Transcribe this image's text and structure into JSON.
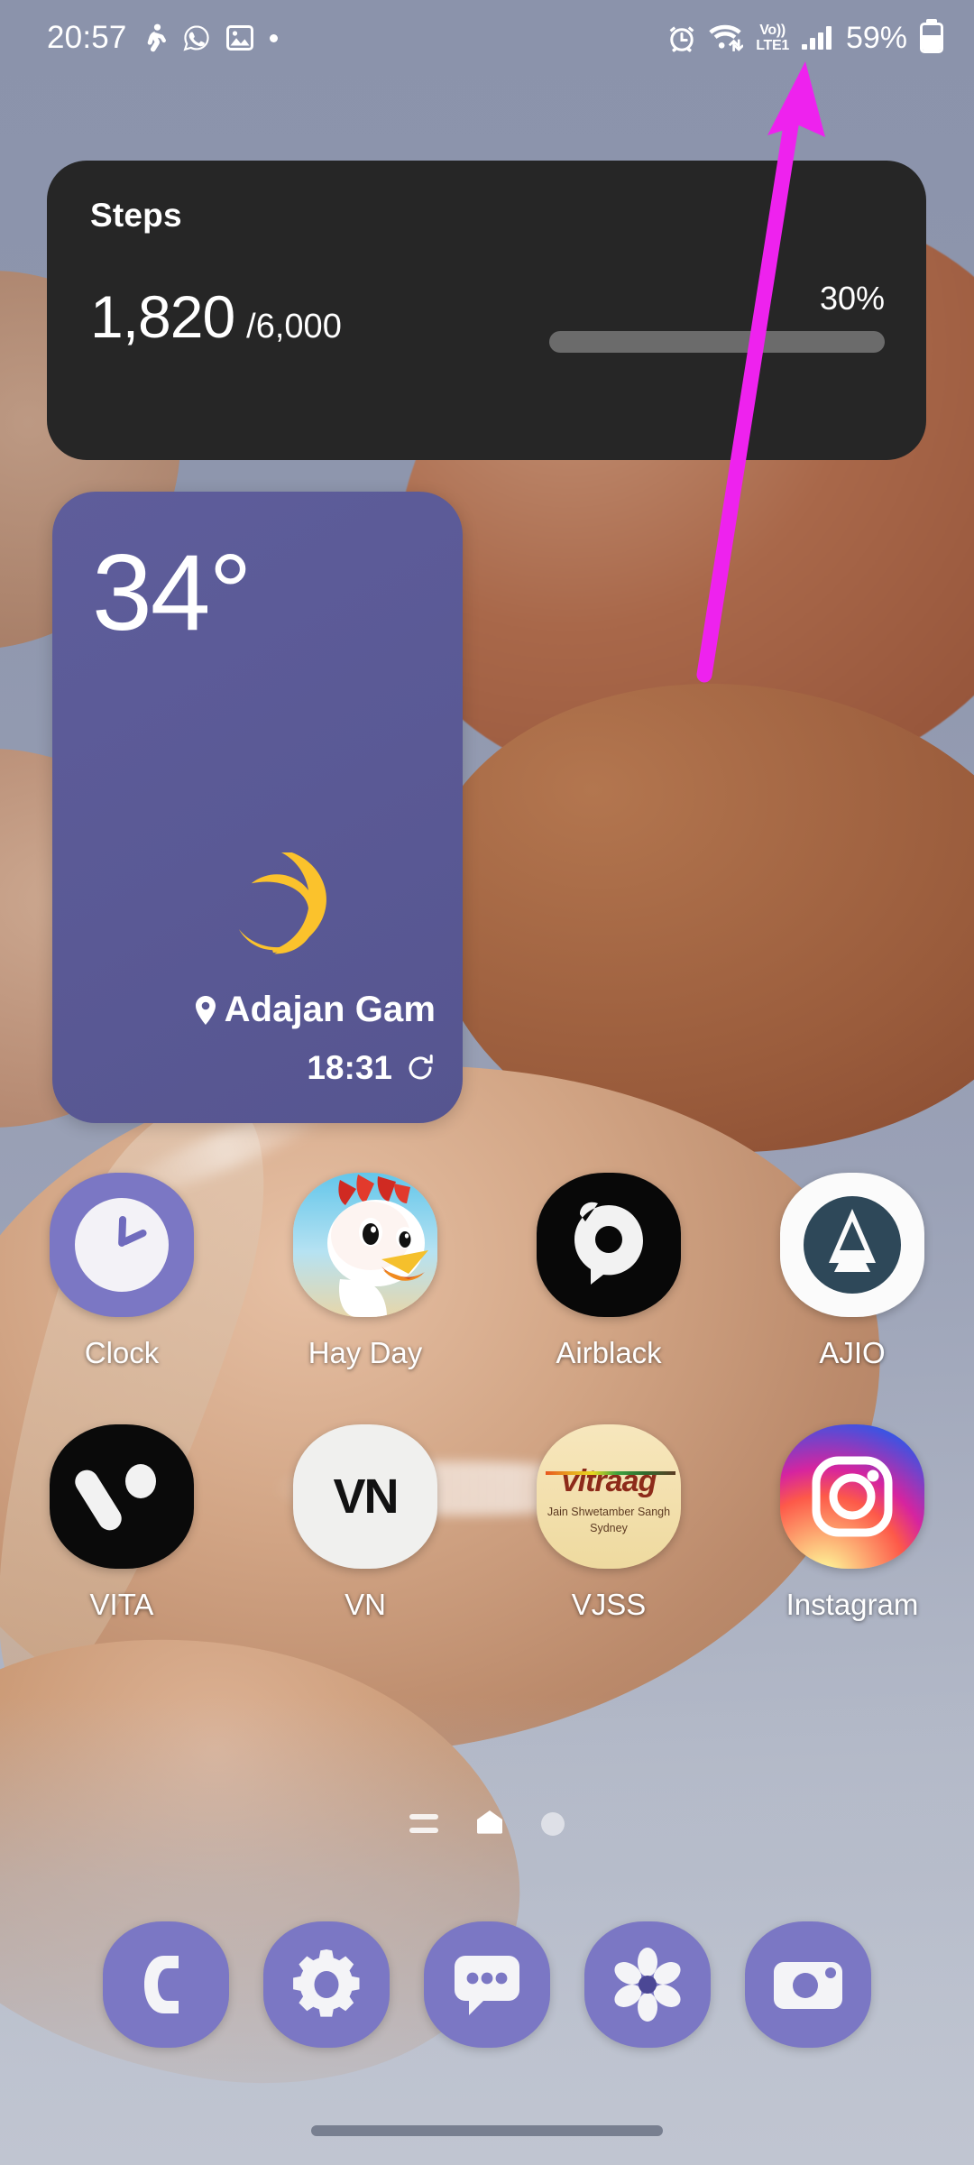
{
  "status_bar": {
    "time": "20:57",
    "left_icons": [
      "running-person-icon",
      "whatsapp-icon",
      "gallery-image-icon",
      "more-notifications-dot"
    ],
    "alarm_icon": "alarm-icon",
    "wifi_icon": "wifi-icon",
    "volte_line1": "Vo))",
    "volte_line2": "LTE1",
    "signal_icon": "signal-bars-icon",
    "battery_percent": "59%",
    "battery_level": 59
  },
  "steps_widget": {
    "title": "Steps",
    "count": "1,820",
    "goal": "/6,000",
    "percent_label": "30%",
    "progress": 30,
    "bar_color": "#26ab5f",
    "track_color": "#6b6b6b",
    "background": "#262626"
  },
  "weather_widget": {
    "temperature": "34°",
    "condition_icon": "crescent-moon-icon",
    "location": "Adajan Gam",
    "location_icon": "location-pin-icon",
    "updated_time": "18:31",
    "refresh_icon": "refresh-icon",
    "background": "#5b5a97"
  },
  "app_grid": {
    "rows": [
      [
        {
          "label": "Clock",
          "icon": "clock-app-icon"
        },
        {
          "label": "Hay Day",
          "icon": "hay-day-app-icon"
        },
        {
          "label": "Airblack",
          "icon": "airblack-app-icon"
        },
        {
          "label": "AJIO",
          "icon": "ajio-app-icon"
        }
      ],
      [
        {
          "label": "VITA",
          "icon": "vita-app-icon"
        },
        {
          "label": "VN",
          "icon": "vn-app-icon"
        },
        {
          "label": "VJSS",
          "icon": "vjss-app-icon"
        },
        {
          "label": "Instagram",
          "icon": "instagram-app-icon"
        }
      ]
    ],
    "vjss_icon_text": {
      "line1": "vitraag",
      "line2": "Jain Shwetamber Sangh",
      "line3": "Sydney"
    },
    "vn_icon_text": "VN"
  },
  "page_indicator": {
    "items": [
      "menu-lines-indicator",
      "home-page-indicator",
      "page-dot-indicator"
    ],
    "active_index": 1
  },
  "dock": {
    "items": [
      {
        "icon": "phone-icon",
        "name": "phone"
      },
      {
        "icon": "gear-icon",
        "name": "settings"
      },
      {
        "icon": "message-bubble-icon",
        "name": "messages"
      },
      {
        "icon": "flower-gallery-icon",
        "name": "gallery"
      },
      {
        "icon": "camera-icon",
        "name": "camera"
      }
    ]
  },
  "annotation": {
    "arrow_color": "#ee22ee",
    "points_to": "signal-bars-icon"
  },
  "navigation": {
    "gesture_pill": "home-gesture-pill"
  }
}
